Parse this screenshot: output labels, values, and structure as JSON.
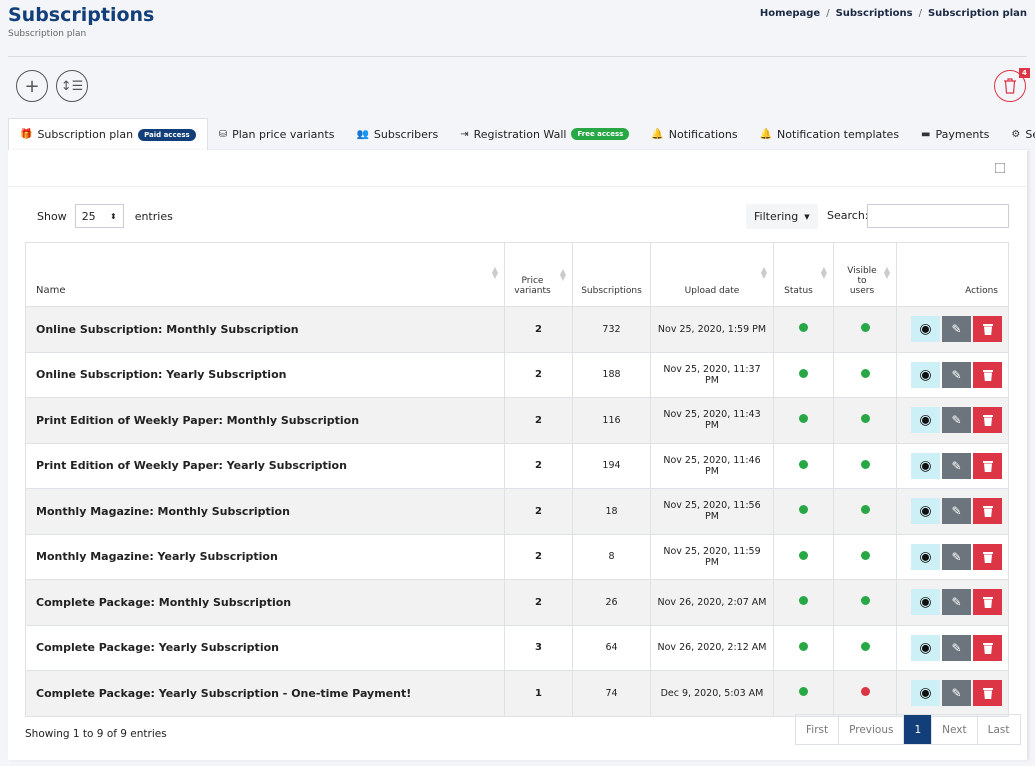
{
  "header": {
    "title": "Subscriptions",
    "subtitle": "Subscription plan",
    "breadcrumb": [
      "Homepage",
      "Subscriptions",
      "Subscription plan"
    ],
    "trash_count": "4"
  },
  "tabs": [
    {
      "label": "Subscription plan",
      "badge": "Paid access",
      "badge_color": "#123f7a",
      "icon": "gift-icon",
      "glyph": "🎁",
      "active": true
    },
    {
      "label": "Plan price variants",
      "icon": "coins-icon",
      "glyph": "⛁"
    },
    {
      "label": "Subscribers",
      "icon": "users-icon",
      "glyph": "👥"
    },
    {
      "label": "Registration Wall",
      "badge": "Free access",
      "badge_color": "#28a745",
      "icon": "sign-in-icon",
      "glyph": "⇥"
    },
    {
      "label": "Notifications",
      "icon": "bell-outline-icon",
      "glyph": "🔔"
    },
    {
      "label": "Notification templates",
      "icon": "bell-icon",
      "glyph": "🔔"
    },
    {
      "label": "Payments",
      "icon": "credit-card-icon",
      "glyph": "▬"
    },
    {
      "label": "Settings",
      "icon": "gear-icon",
      "glyph": "⚙"
    }
  ],
  "controls": {
    "show_label": "Show",
    "entries_value": "25",
    "entries_label": "entries",
    "filtering": "Filtering",
    "search_label": "Search:",
    "search_value": ""
  },
  "table": {
    "columns": [
      "Name",
      "Price variants",
      "Subscriptions",
      "Upload date",
      "Status",
      "Visible to users",
      "Actions"
    ],
    "rows": [
      {
        "name": "Online Subscription: Monthly Subscription",
        "variants": "2",
        "subs": "732",
        "date": "Nov 25, 2020, 1:59 PM",
        "status": "green",
        "visible": "green"
      },
      {
        "name": "Online Subscription: Yearly Subscription",
        "variants": "2",
        "subs": "188",
        "date": "Nov 25, 2020, 11:37 PM",
        "status": "green",
        "visible": "green"
      },
      {
        "name": "Print Edition of Weekly Paper: Monthly Subscription",
        "variants": "2",
        "subs": "116",
        "date": "Nov 25, 2020, 11:43 PM",
        "status": "green",
        "visible": "green"
      },
      {
        "name": "Print Edition of Weekly Paper: Yearly Subscription",
        "variants": "2",
        "subs": "194",
        "date": "Nov 25, 2020, 11:46 PM",
        "status": "green",
        "visible": "green"
      },
      {
        "name": "Monthly Magazine: Monthly Subscription",
        "variants": "2",
        "subs": "18",
        "date": "Nov 25, 2020, 11:56 PM",
        "status": "green",
        "visible": "green"
      },
      {
        "name": "Monthly Magazine: Yearly Subscription",
        "variants": "2",
        "subs": "8",
        "date": "Nov 25, 2020, 11:59 PM",
        "status": "green",
        "visible": "green"
      },
      {
        "name": "Complete Package: Monthly Subscription",
        "variants": "2",
        "subs": "26",
        "date": "Nov 26, 2020, 2:07 AM",
        "status": "green",
        "visible": "green"
      },
      {
        "name": "Complete Package: Yearly Subscription",
        "variants": "3",
        "subs": "64",
        "date": "Nov 26, 2020, 2:12 AM",
        "status": "green",
        "visible": "green"
      },
      {
        "name": "Complete Package: Yearly Subscription - One-time Payment!",
        "variants": "1",
        "subs": "74",
        "date": "Dec 9, 2020, 5:03 AM",
        "status": "green",
        "visible": "red"
      }
    ]
  },
  "colors": {
    "green": "#28a745",
    "red": "#dc3545",
    "view": "#cdeff6",
    "edit": "#6c757d",
    "delete": "#dc3545"
  },
  "footer": {
    "info": "Showing 1 to 9 of 9 entries",
    "pager": [
      "First",
      "Previous",
      "1",
      "Next",
      "Last"
    ],
    "current_page": "1"
  }
}
